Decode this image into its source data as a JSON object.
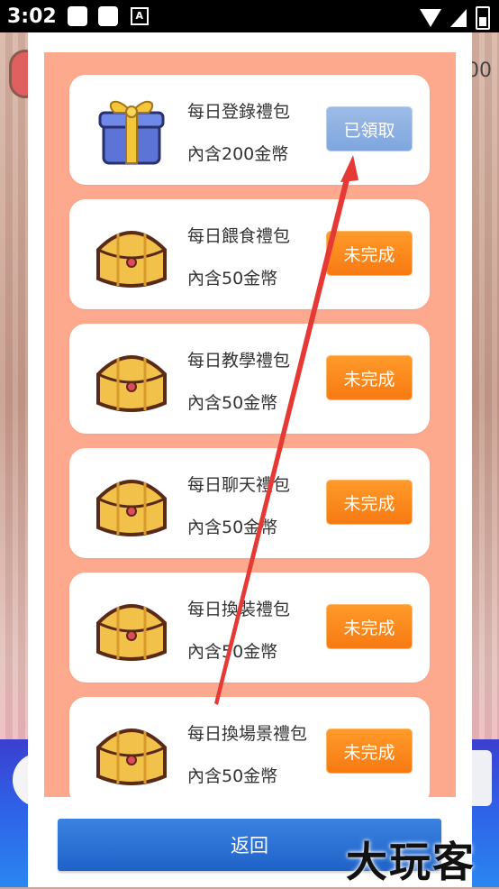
{
  "status_bar": {
    "time": "3:02",
    "notification_letter": "A"
  },
  "background": {
    "right_text": "00"
  },
  "tasks": [
    {
      "title": "每日登錄禮包",
      "desc": "內含200金幣",
      "button": "已領取",
      "state": "claimed",
      "icon": "gift-box-icon"
    },
    {
      "title": "每日餵食禮包",
      "desc": "內含50金幣",
      "button": "未完成",
      "state": "pending",
      "icon": "treasure-chest-icon"
    },
    {
      "title": "每日教學禮包",
      "desc": "內含50金幣",
      "button": "未完成",
      "state": "pending",
      "icon": "treasure-chest-icon"
    },
    {
      "title": "每日聊天禮包",
      "desc": "內含50金幣",
      "button": "未完成",
      "state": "pending",
      "icon": "treasure-chest-icon"
    },
    {
      "title": "每日換裝禮包",
      "desc": "內含50金幣",
      "button": "未完成",
      "state": "pending",
      "icon": "treasure-chest-icon"
    },
    {
      "title": "每日換場景禮包",
      "desc": "內含50金幣",
      "button": "未完成",
      "state": "pending",
      "icon": "treasure-chest-icon"
    }
  ],
  "back_label": "返回",
  "watermark": "大玩客",
  "colors": {
    "panel": "#fda98e",
    "claimed_button": "#8fb1e3",
    "pending_button": "#f9861a",
    "back_button": "#2a6fd4",
    "annotation_arrow": "#e53935"
  }
}
